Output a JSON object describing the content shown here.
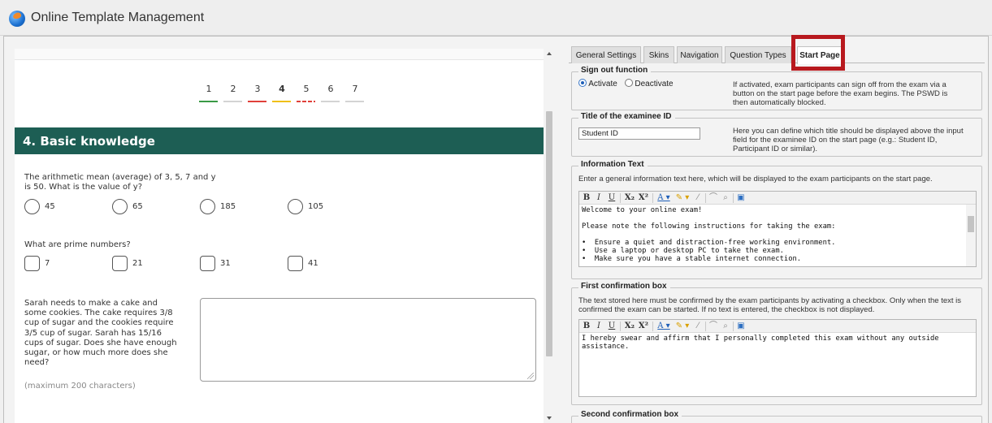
{
  "app": {
    "title": "Online Template Management"
  },
  "preview": {
    "pagination": [
      {
        "label": "1",
        "status": "green",
        "current": false
      },
      {
        "label": "2",
        "status": "none",
        "current": false
      },
      {
        "label": "3",
        "status": "red",
        "current": false
      },
      {
        "label": "4",
        "status": "yellow",
        "current": true
      },
      {
        "label": "5",
        "status": "red-dashed",
        "current": false
      },
      {
        "label": "6",
        "status": "none",
        "current": false
      },
      {
        "label": "7",
        "status": "none",
        "current": false
      }
    ],
    "section_title": "4. Basic knowledge",
    "question1": {
      "text_line1": "The arithmetic mean (average) of 3, 5, 7 and y",
      "text_line2": "is 50. What is the value of y?",
      "options": [
        "45",
        "65",
        "185",
        "105"
      ]
    },
    "question2": {
      "text": "What are prime numbers?",
      "options": [
        "7",
        "21",
        "31",
        "41"
      ]
    },
    "question3": {
      "lines": [
        "Sarah needs to make a cake and",
        "some cookies. The cake requires 3/8",
        "cup of sugar and the cookies require",
        "3/5 cup of sugar. Sarah has 15/16",
        "cups of sugar. Does she have enough",
        "sugar, or how much more does she",
        "need?"
      ],
      "answer_value": "",
      "max_chars": "(maximum 200 characters)"
    }
  },
  "settings": {
    "tabs": [
      {
        "label": "General Settings",
        "active": false
      },
      {
        "label": "Skins",
        "active": false
      },
      {
        "label": "Navigation",
        "active": false
      },
      {
        "label": "Question Types",
        "active": false
      },
      {
        "label": "Start Page",
        "active": true
      }
    ],
    "sign_out": {
      "legend": "Sign out function",
      "activate_label": "Activate",
      "deactivate_label": "Deactivate",
      "selected": "Activate",
      "desc_lines": [
        "If activated, exam participants can sign off from the exam via a",
        "button on the start page before the exam begins. The PSWD is",
        "then automatically blocked."
      ]
    },
    "examinee_id": {
      "legend": "Title of the examinee ID",
      "value": "Student ID",
      "desc_lines": [
        "Here you can define which title should be displayed above the input",
        "field for the examinee ID on the start page (e.g.: Student ID,",
        "Participant ID or similar)."
      ]
    },
    "info_text": {
      "legend": "Information Text",
      "desc": "Enter a general information text here, which will be displayed to the exam participants on the start page.",
      "content": "Welcome to your online exam!\n\nPlease note the following instructions for taking the exam:\n\n•  Ensure a quiet and distraction-free working environment.\n•  Use a laptop or desktop PC to take the exam.\n•  Make sure you have a stable internet connection."
    },
    "first_confirmation": {
      "legend": "First confirmation box",
      "desc_line1": "The text stored here must be confirmed by the exam participants by activating a checkbox. Only when the text is",
      "desc_line2": "confirmed the exam can be started. If no text is entered, the checkbox is not displayed.",
      "content": "I hereby swear and affirm that I personally completed this exam without any outside\nassistance."
    },
    "second_confirmation": {
      "legend": "Second confirmation box"
    },
    "toolbar": {
      "bold": "B",
      "italic": "I",
      "underline": "U",
      "subscript": "X₂",
      "superscript": "X²",
      "font_color": "A ▾",
      "highlight": "✎ ▾",
      "clear_format": "⁄",
      "link": "⌒",
      "unlink": "⌕",
      "source": "▣"
    }
  }
}
